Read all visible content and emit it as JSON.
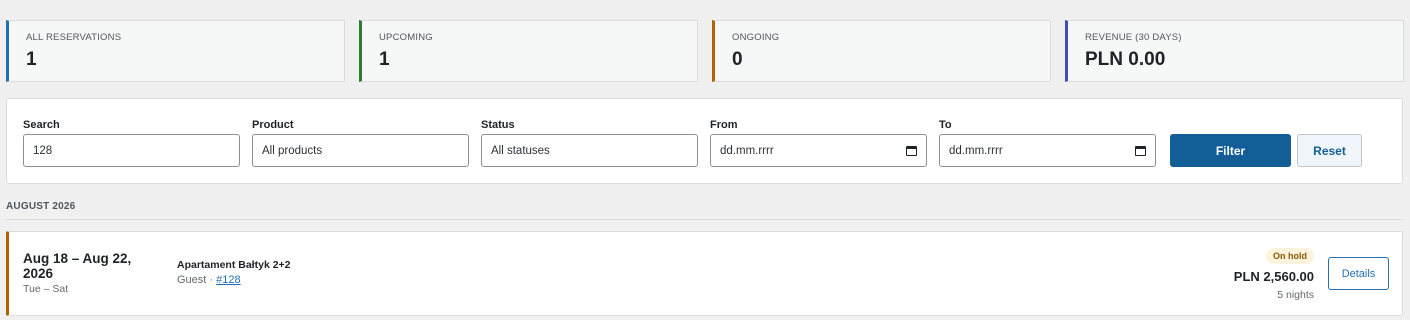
{
  "stats": [
    {
      "label": "ALL RESERVATIONS",
      "value": "1",
      "accent": "#2271b1"
    },
    {
      "label": "UPCOMING",
      "value": "1",
      "accent": "#2e7d32"
    },
    {
      "label": "ONGOING",
      "value": "0",
      "accent": "#b26200"
    },
    {
      "label": "REVENUE (30 DAYS)",
      "value": "PLN 0.00",
      "accent": "#3f51b5"
    }
  ],
  "filters": {
    "search": {
      "label": "Search",
      "value": "128"
    },
    "product": {
      "label": "Product",
      "value": "All products"
    },
    "status": {
      "label": "Status",
      "value": "All statuses"
    },
    "from": {
      "label": "From",
      "value": "dd.mm.rrrr",
      "icon": "calendar-icon"
    },
    "to": {
      "label": "To",
      "value": "dd.mm.rrrr",
      "icon": "calendar-icon"
    },
    "filter_button": "Filter",
    "reset_button": "Reset"
  },
  "groups": [
    {
      "month": "AUGUST 2026",
      "reservations": [
        {
          "date_range": "Aug 18 – Aug 22, 2026",
          "days": "Tue – Sat",
          "product": "Apartament Bałtyk 2+2",
          "guest_prefix": "Guest · ",
          "ref": "#128",
          "status": "On hold",
          "price": "PLN 2,560.00",
          "nights": "5 nights",
          "details_button": "Details",
          "accent": "#b26200"
        }
      ]
    }
  ]
}
